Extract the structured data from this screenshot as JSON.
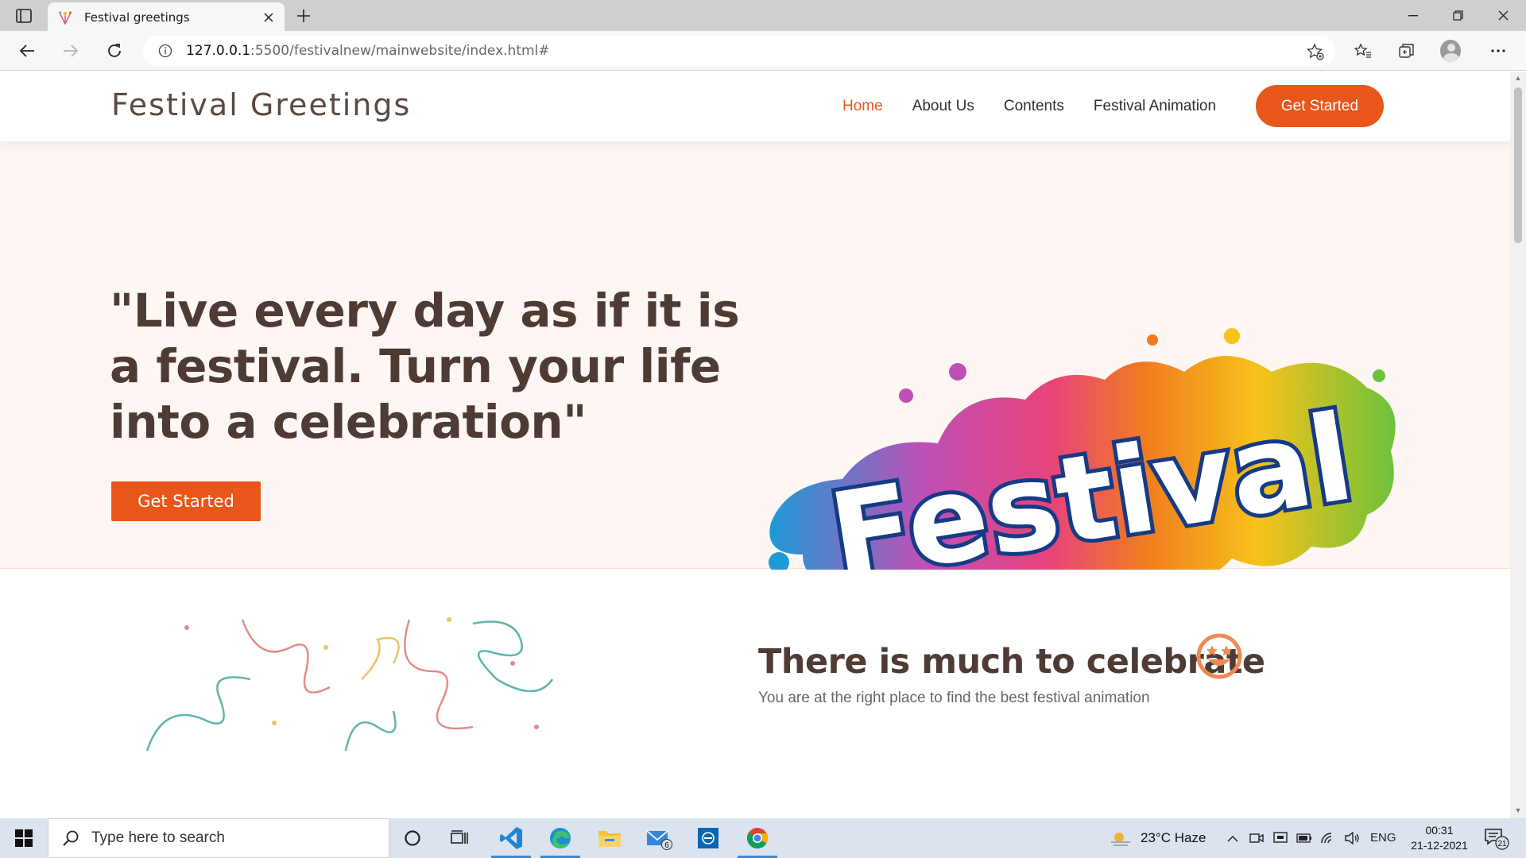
{
  "browser": {
    "tab_title": "Festival greetings",
    "url_host": "127.0.0.1",
    "url_rest": ":5500/festivalnew/mainwebsite/index.html#"
  },
  "site": {
    "logo": "Festival Greetings",
    "nav": [
      "Home",
      "About Us",
      "Contents",
      "Festival Animation"
    ],
    "nav_cta": "Get Started",
    "hero_quote": "\"Live every day as if it is a festival. Turn your life into a celebration\"",
    "hero_button": "Get Started",
    "hero_art_text": "Festival",
    "section_title": "There is much to celebrate",
    "section_subtitle": "You are at the right place to find the best festival animation",
    "accent_color": "#e8561a"
  },
  "taskbar": {
    "search_placeholder": "Type here to search",
    "weather": "23°C  Haze",
    "lang": "ENG",
    "time": "00:31",
    "date": "21-12-2021",
    "mail_badge": "6",
    "notif_badge": "21"
  }
}
